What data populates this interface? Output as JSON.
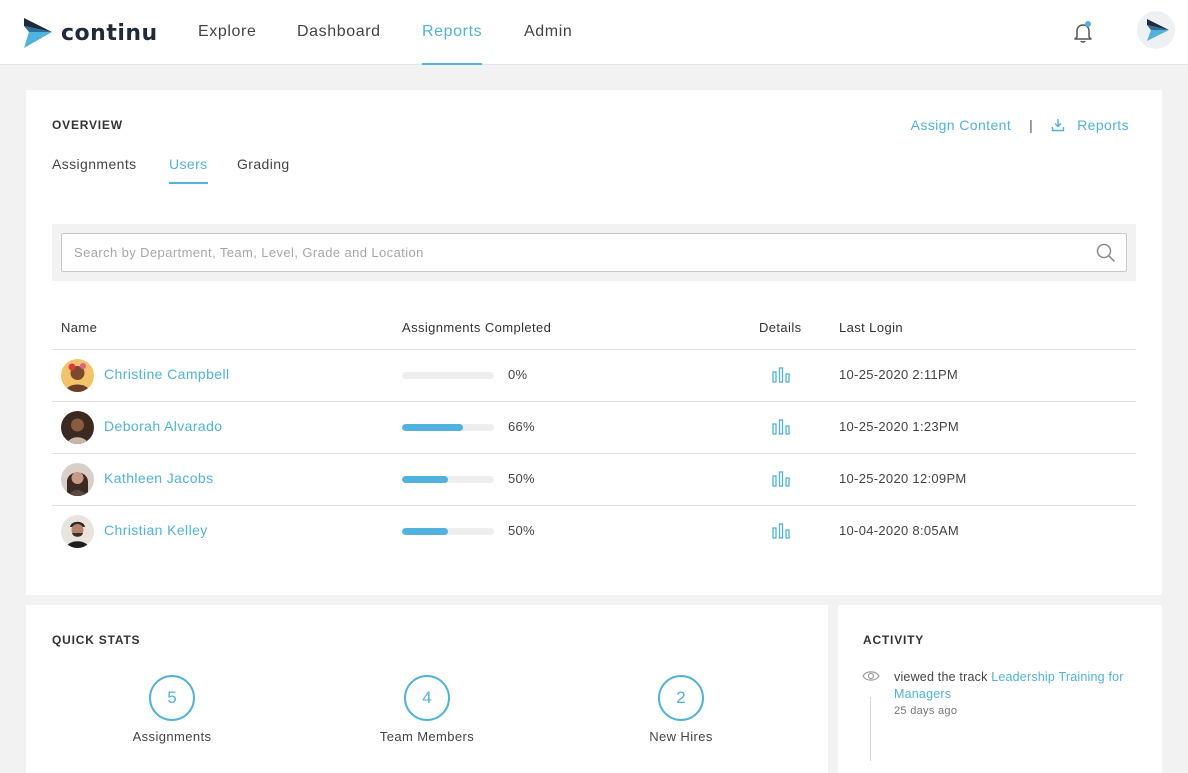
{
  "brand": {
    "name": "continu",
    "accent": "#4fb3de"
  },
  "nav": {
    "items": [
      {
        "label": "Explore"
      },
      {
        "label": "Dashboard"
      },
      {
        "label": "Reports",
        "active": true
      },
      {
        "label": "Admin"
      }
    ],
    "icons": [
      "bell-icon",
      "user-avatar"
    ]
  },
  "overview": {
    "title": "OVERVIEW",
    "assign_content": "Assign Content",
    "separator": "|",
    "reports": "Reports",
    "tabs": [
      {
        "label": "Assignments"
      },
      {
        "label": "Users",
        "active": true
      },
      {
        "label": "Grading"
      }
    ],
    "search": {
      "placeholder": "Search by Department, Team, Level, Grade and Location",
      "value": ""
    },
    "table": {
      "headers": [
        "Name",
        "Assignments Completed",
        "Details",
        "Last Login"
      ],
      "rows": [
        {
          "name": "Christine Campbell",
          "progress": 0,
          "percent": "0%",
          "last_login": "10-25-2020 2:11PM"
        },
        {
          "name": "Deborah Alvarado",
          "progress": 66,
          "percent": "66%",
          "last_login": "10-25-2020 1:23PM"
        },
        {
          "name": "Kathleen Jacobs",
          "progress": 50,
          "percent": "50%",
          "last_login": "10-25-2020 12:09PM"
        },
        {
          "name": "Christian Kelley",
          "progress": 50,
          "percent": "50%",
          "last_login": "10-04-2020 8:05AM"
        }
      ]
    }
  },
  "quick_stats": {
    "title": "QUICK STATS",
    "items": [
      {
        "value": "5",
        "label": "Assignments"
      },
      {
        "value": "4",
        "label": "Team Members"
      },
      {
        "value": "2",
        "label": "New Hires"
      }
    ]
  },
  "activity": {
    "title": "ACTIVITY",
    "entries": [
      {
        "prefix": "viewed the track ",
        "link": "Leadership Training for Managers",
        "time": "25 days ago"
      }
    ]
  }
}
